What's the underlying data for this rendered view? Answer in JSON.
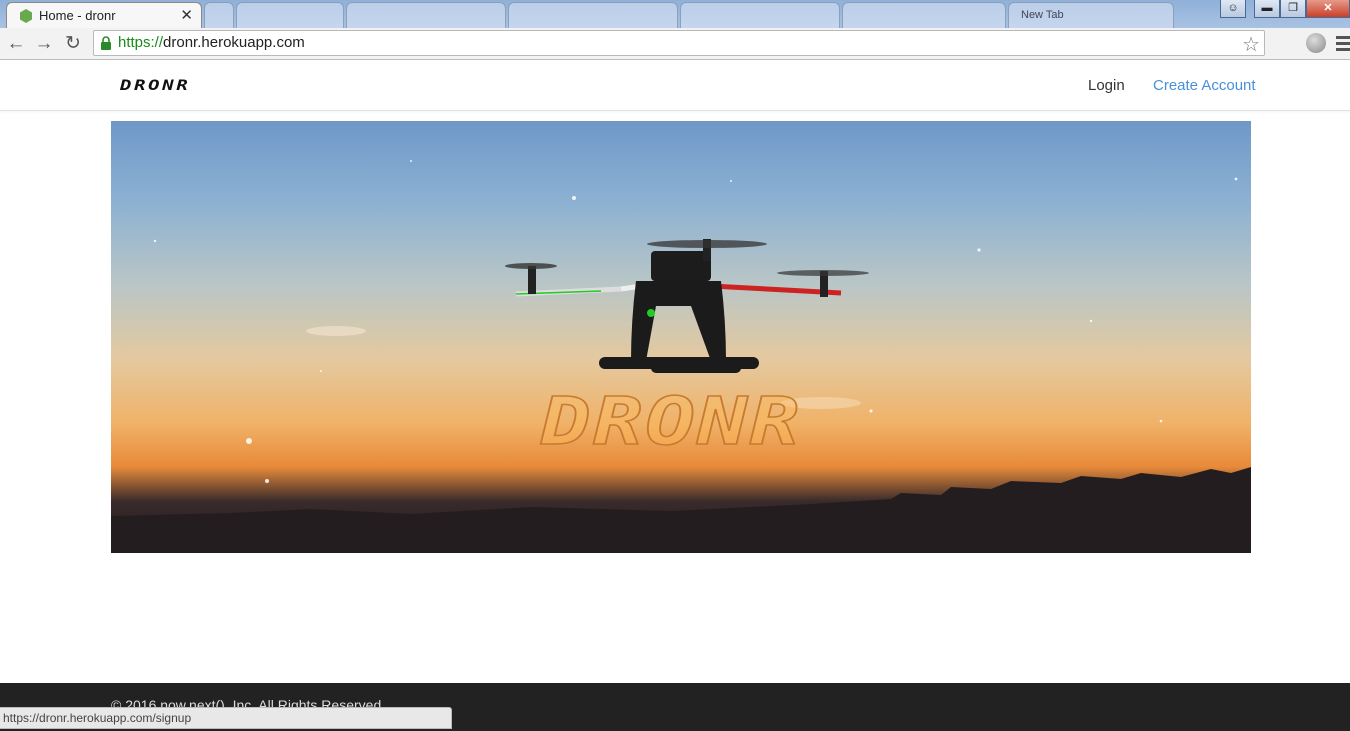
{
  "browser": {
    "active_tab": {
      "title": "Home - dronr",
      "close_glyph": "✕"
    },
    "background_tabs": [
      "",
      "",
      "",
      "",
      "",
      "",
      "New Tab"
    ],
    "url_scheme": "https://",
    "url_host": "dronr.herokuapp.com",
    "status_url": "https://dronr.herokuapp.com/signup",
    "icons": {
      "back": "back-arrow-icon",
      "forward": "forward-arrow-icon",
      "reload": "reload-icon",
      "lock": "lock-icon",
      "star": "bookmark-star-icon",
      "extension": "extension-icon",
      "menu": "menu-icon"
    },
    "window_buttons": {
      "minimize": "▬",
      "maximize": "❐",
      "close": "✕"
    }
  },
  "site": {
    "brand": "DRONR",
    "nav": {
      "login": "Login",
      "create_account": "Create Account"
    },
    "hero": {
      "logo_text": "DRONR",
      "alt": "drone over sunset"
    },
    "footer": {
      "copyright": "© 2016 now.next(), Inc. All Rights Reserved"
    },
    "colors": {
      "link_accent": "#4a90d9",
      "footer_bg": "#222222",
      "url_scheme": "#1a8a1a"
    }
  }
}
